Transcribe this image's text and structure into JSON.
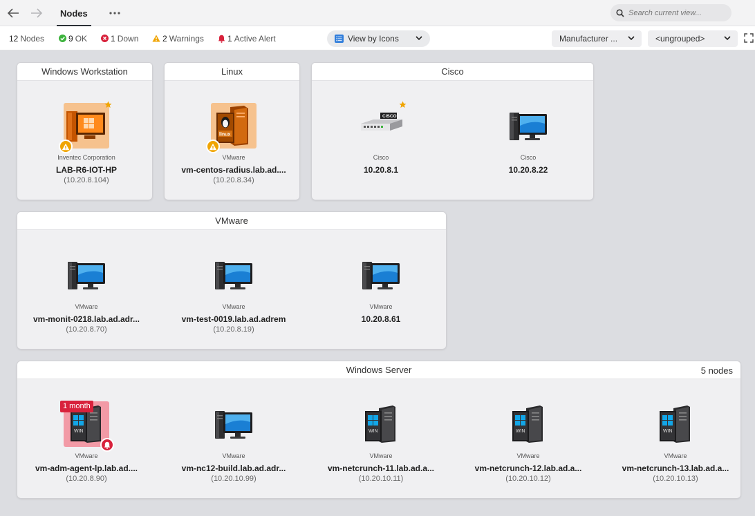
{
  "nav": {
    "tab_title": "Nodes",
    "search_placeholder": "Search current view..."
  },
  "status": {
    "nodes_count": "12",
    "nodes_label": "Nodes",
    "ok_count": "9",
    "ok_label": "OK",
    "down_count": "1",
    "down_label": "Down",
    "warn_count": "2",
    "warn_label": "Warnings",
    "alert_count": "1",
    "alert_label": "Active Alert"
  },
  "toolbar": {
    "view_label": "View by Icons",
    "manufacturer_label": "Manufacturer ...",
    "grouping_label": "<ungrouped>"
  },
  "colors": {
    "warning": "#f0a400",
    "alert": "#d8223c",
    "ok": "#3db33d",
    "accent": "#2f7ddb"
  },
  "groups": [
    {
      "title": "Windows Workstation",
      "count": "",
      "nodes": [
        {
          "maker": "Inventec Corporation",
          "name": "LAB-R6-IOT-HP",
          "ip": "(10.20.8.104)",
          "icon": "windows-workstation-icon",
          "status": "warning",
          "starred": true
        }
      ]
    },
    {
      "title": "Linux",
      "count": "",
      "nodes": [
        {
          "maker": "VMware",
          "name": "vm-centos-radius.lab.ad....",
          "ip": "(10.20.8.34)",
          "icon": "linux-server-icon",
          "status": "warning",
          "starred": false
        }
      ]
    },
    {
      "title": "Cisco",
      "count": "",
      "nodes": [
        {
          "maker": "Cisco",
          "name": "10.20.8.1",
          "ip": "",
          "icon": "cisco-switch-icon",
          "status": "ok",
          "starred": true
        },
        {
          "maker": "Cisco",
          "name": "10.20.8.22",
          "ip": "",
          "icon": "computer-icon",
          "status": "ok",
          "starred": false
        }
      ]
    },
    {
      "title": "VMware",
      "count": "",
      "nodes": [
        {
          "maker": "VMware",
          "name": "vm-monit-0218.lab.ad.adr...",
          "ip": "(10.20.8.70)",
          "icon": "computer-icon",
          "status": "ok"
        },
        {
          "maker": "VMware",
          "name": "vm-test-0019.lab.ad.adrem",
          "ip": "(10.20.8.19)",
          "icon": "computer-icon",
          "status": "ok"
        },
        {
          "maker": "VMware",
          "name": "10.20.8.61",
          "ip": "",
          "icon": "computer-icon",
          "status": "ok"
        }
      ]
    },
    {
      "title": "Windows Server",
      "count": "5 nodes",
      "nodes": [
        {
          "maker": "VMware",
          "name": "vm-adm-agent-lp.lab.ad....",
          "ip": "(10.20.8.90)",
          "icon": "windows-server-icon",
          "status": "down",
          "age": "1 month"
        },
        {
          "maker": "VMware",
          "name": "vm-nc12-build.lab.ad.adr...",
          "ip": "(10.20.10.99)",
          "icon": "computer-icon",
          "status": "ok"
        },
        {
          "maker": "VMware",
          "name": "vm-netcrunch-11.lab.ad.a...",
          "ip": "(10.20.10.11)",
          "icon": "windows-server-icon",
          "status": "ok"
        },
        {
          "maker": "VMware",
          "name": "vm-netcrunch-12.lab.ad.a...",
          "ip": "(10.20.10.12)",
          "icon": "windows-server-icon",
          "status": "ok"
        },
        {
          "maker": "VMware",
          "name": "vm-netcrunch-13.lab.ad.a...",
          "ip": "(10.20.10.13)",
          "icon": "windows-server-icon",
          "status": "ok"
        }
      ]
    }
  ]
}
